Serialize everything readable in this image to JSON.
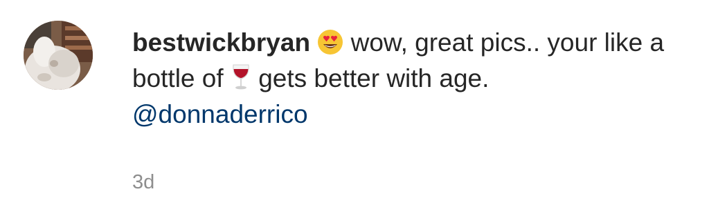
{
  "comment": {
    "username": "bestwickbryan",
    "text_part1": " wow, great pics.. your like a bottle of ",
    "text_part2": " gets better with age.",
    "mention": "@donnaderrico",
    "timestamp": "3d",
    "emoji_1": "heart-eyes-emoji",
    "emoji_2": "wine-glass-emoji"
  },
  "colors": {
    "text": "#262626",
    "mention": "#00376b",
    "timestamp": "#8e8e8e"
  }
}
